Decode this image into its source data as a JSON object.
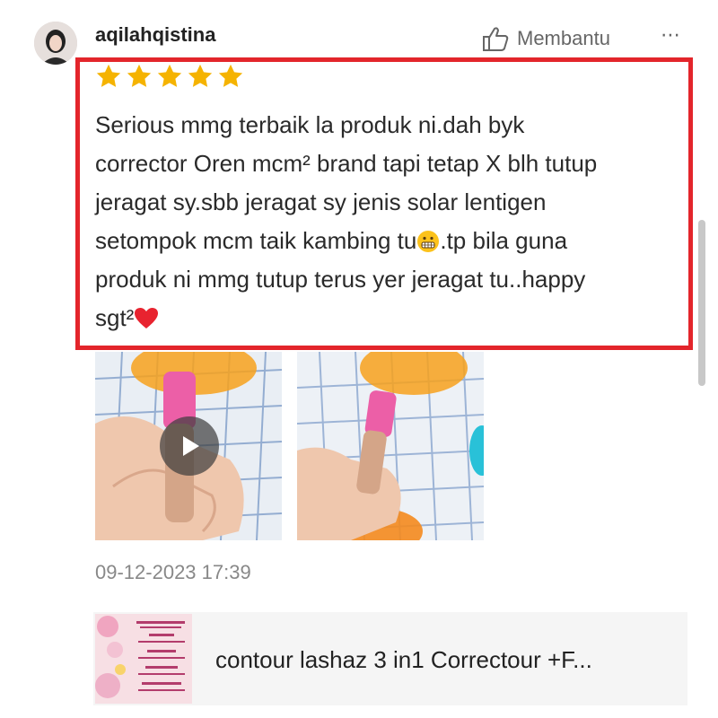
{
  "review": {
    "username": "aqilahqistina",
    "helpful_label": "Membantu",
    "more_label": "⋯",
    "rating": 5,
    "text_lines": [
      "Serious mmg terbaik la produk ni.dah byk",
      "corrector Oren mcm² brand tapi tetap X blh tutup",
      "jeragat sy.sbb jeragat sy jenis solar lentigen"
    ],
    "line4_before": "setompok mcm taik kambing tu",
    "line4_after": ".tp bila guna",
    "line5": "produk ni mmg tutup terus yer jeragat tu..happy",
    "line6": "sgt²",
    "date": "09-12-2023 17:39"
  },
  "product": {
    "title": "contour lashaz 3 in1  Correctour +F..."
  },
  "colors": {
    "highlight": "#e3252b",
    "star": "#f5b301",
    "heart": "#e8232f"
  },
  "icons": [
    "thumbs-up-icon",
    "more-icon",
    "star-icon",
    "play-icon",
    "grimace-emoji-icon",
    "heart-icon"
  ]
}
